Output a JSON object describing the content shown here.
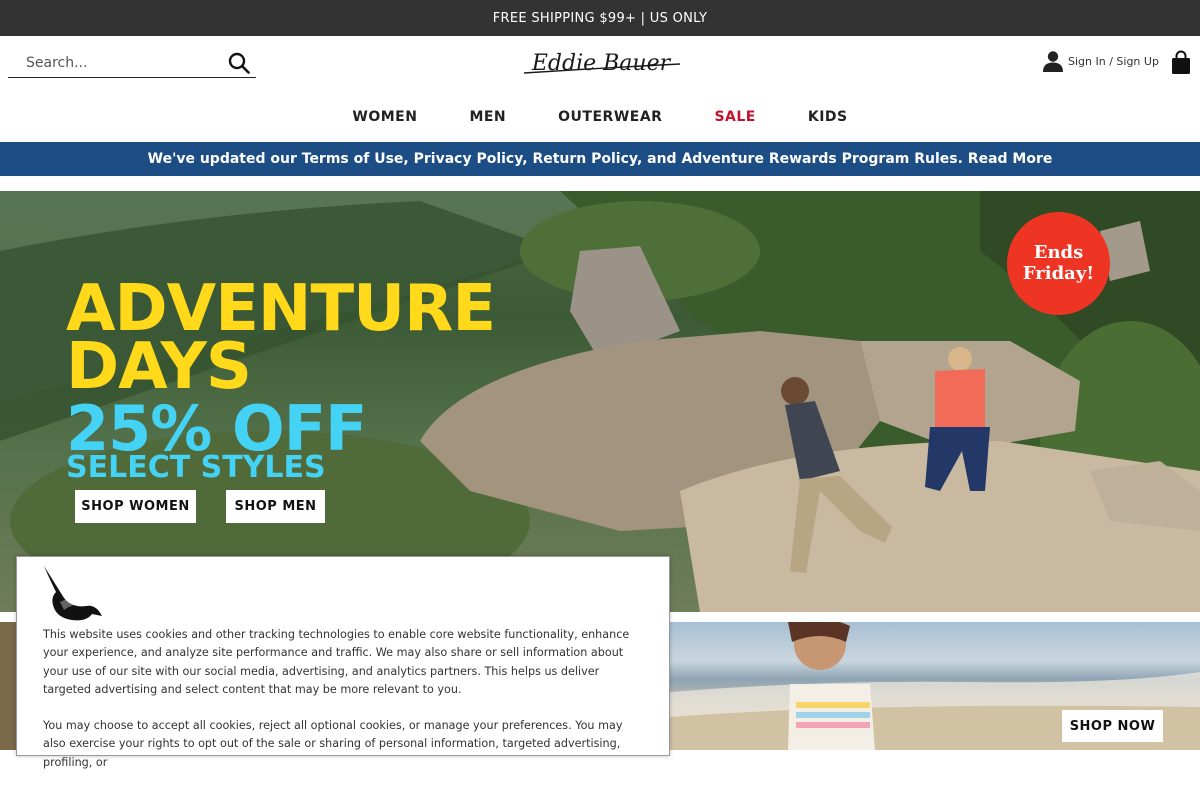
{
  "promo": {
    "text": "FREE SHIPPING $99+ | US ONLY"
  },
  "header": {
    "search_placeholder": "Search...",
    "logo_text": "Eddie Bauer",
    "account_label": "Sign In / Sign Up"
  },
  "nav": {
    "items": [
      {
        "label": "WOMEN"
      },
      {
        "label": "MEN"
      },
      {
        "label": "OUTERWEAR"
      },
      {
        "label": "SALE"
      },
      {
        "label": "KIDS"
      }
    ],
    "sale_color": "#c8102e"
  },
  "notice": {
    "text": "We've updated our Terms of Use, Privacy Policy, Return Policy, and Adventure Rewards Program Rules. Read More"
  },
  "hero": {
    "headline_line1": "ADVENTURE",
    "headline_line2": "DAYS",
    "headline_line3": "25% OFF",
    "headline_line4": "SELECT STYLES",
    "badge_line1": "Ends",
    "badge_line2": "Friday!",
    "buttons": [
      {
        "label": "SHOP WOMEN"
      },
      {
        "label": "SHOP MEN"
      }
    ],
    "colors": {
      "yellow": "#ffd91a",
      "cyan": "#45d3f5",
      "badge": "#ee3524"
    }
  },
  "secondary": {
    "shop_now_label": "SHOP NOW"
  },
  "cookie": {
    "paragraph1": "This website uses cookies and other tracking technologies to enable core website functionality, enhance your experience, and analyze site performance and traffic. We may also share or sell information about your use of our site with our social media, advertising, and analytics partners. This helps us deliver targeted advertising and select content that may be more relevant to you.",
    "paragraph2": "You may choose to accept all cookies, reject all optional cookies, or manage your preferences. You may also exercise your rights to opt out of the sale or sharing of personal information, targeted advertising, profiling, or"
  },
  "colors": {
    "promo_bg": "#333333",
    "notice_bg": "#1d4d85"
  }
}
